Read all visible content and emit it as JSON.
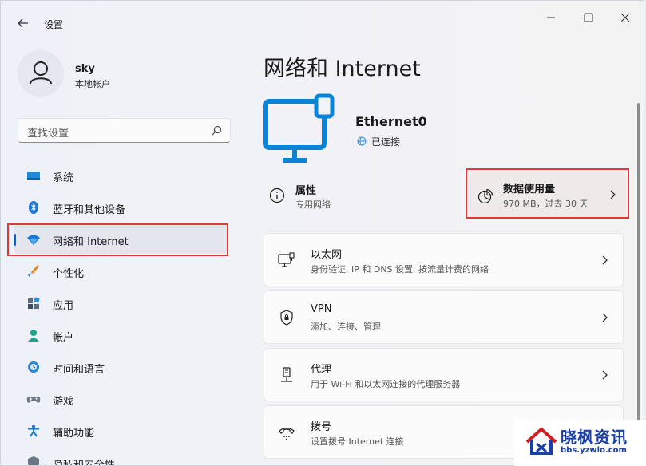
{
  "window": {
    "title": "设置"
  },
  "account": {
    "name": "sky",
    "type": "本地帐户"
  },
  "search": {
    "placeholder": "查找设置"
  },
  "nav": {
    "items": [
      {
        "label": "系统",
        "icon": "display-icon"
      },
      {
        "label": "蓝牙和其他设备",
        "icon": "bluetooth-icon"
      },
      {
        "label": "网络和 Internet",
        "icon": "wifi-icon",
        "selected": true
      },
      {
        "label": "个性化",
        "icon": "brush-icon"
      },
      {
        "label": "应用",
        "icon": "apps-icon"
      },
      {
        "label": "帐户",
        "icon": "person-icon"
      },
      {
        "label": "时间和语言",
        "icon": "globe-clock-icon"
      },
      {
        "label": "游戏",
        "icon": "gamepad-icon"
      },
      {
        "label": "辅助功能",
        "icon": "accessibility-icon"
      },
      {
        "label": "隐私和安全性",
        "icon": "shield-icon"
      }
    ]
  },
  "main": {
    "title": "网络和 Internet",
    "connection": {
      "name": "Ethernet0",
      "status": "已连接"
    },
    "properties": {
      "title": "属性",
      "subtitle": "专用网络"
    },
    "data_usage": {
      "title": "数据使用量",
      "subtitle": "970 MB，过去 30 天"
    },
    "cards": [
      {
        "title": "以太网",
        "subtitle": "身份验证, IP 和 DNS 设置, 按流量计费的网络",
        "icon": "ethernet-icon"
      },
      {
        "title": "VPN",
        "subtitle": "添加、连接、管理",
        "icon": "vpn-shield-icon"
      },
      {
        "title": "代理",
        "subtitle": "用于 Wi-Fi 和以太网连接的代理服务器",
        "icon": "proxy-icon"
      },
      {
        "title": "拨号",
        "subtitle": "设置拨号 Internet 连接",
        "icon": "dialup-icon"
      }
    ]
  },
  "watermark": {
    "title": "晓枫资讯",
    "url": "bbs.yzwlo.com"
  },
  "colors": {
    "accent": "#0b5fc4",
    "highlight_box": "#e0393b",
    "icon_blue": "#0a84d6",
    "watermark": "#1b3fa8"
  }
}
